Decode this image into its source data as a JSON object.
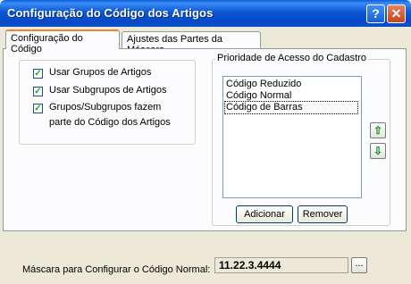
{
  "window": {
    "title": "Configuração do Código dos Artigos",
    "help_glyph": "?",
    "close_glyph": "✕"
  },
  "tabs": [
    {
      "label": "Configuração do Código",
      "active": true
    },
    {
      "label": "Ajustes das Partes da Máscara",
      "active": false
    }
  ],
  "options": [
    {
      "label": "Usar Grupos de Artigos",
      "checked": true
    },
    {
      "label": "Usar Subgrupos de Artigos",
      "checked": true
    },
    {
      "label_line1": "Grupos/Subgrupos fazem",
      "label_line2": "parte do Código dos Artigos",
      "checked": true
    }
  ],
  "priority": {
    "legend": "Prioridade de Acesso do Cadastro",
    "items": [
      "Código Reduzido",
      "Código Normal",
      "Código de Barras"
    ],
    "focused_index": 2,
    "up_icon": "arrow-up-icon",
    "down_icon": "arrow-down-icon",
    "add_label": "Adicionar",
    "remove_label": "Remover"
  },
  "mask": {
    "label": "Máscara para Configurar o Código Normal:",
    "value": "11.22.3.4444",
    "browse_label": "..."
  },
  "colors": {
    "title_bar": "#0a58d4",
    "check_mark": "#21a121",
    "arrow": "#1b8a2e"
  }
}
